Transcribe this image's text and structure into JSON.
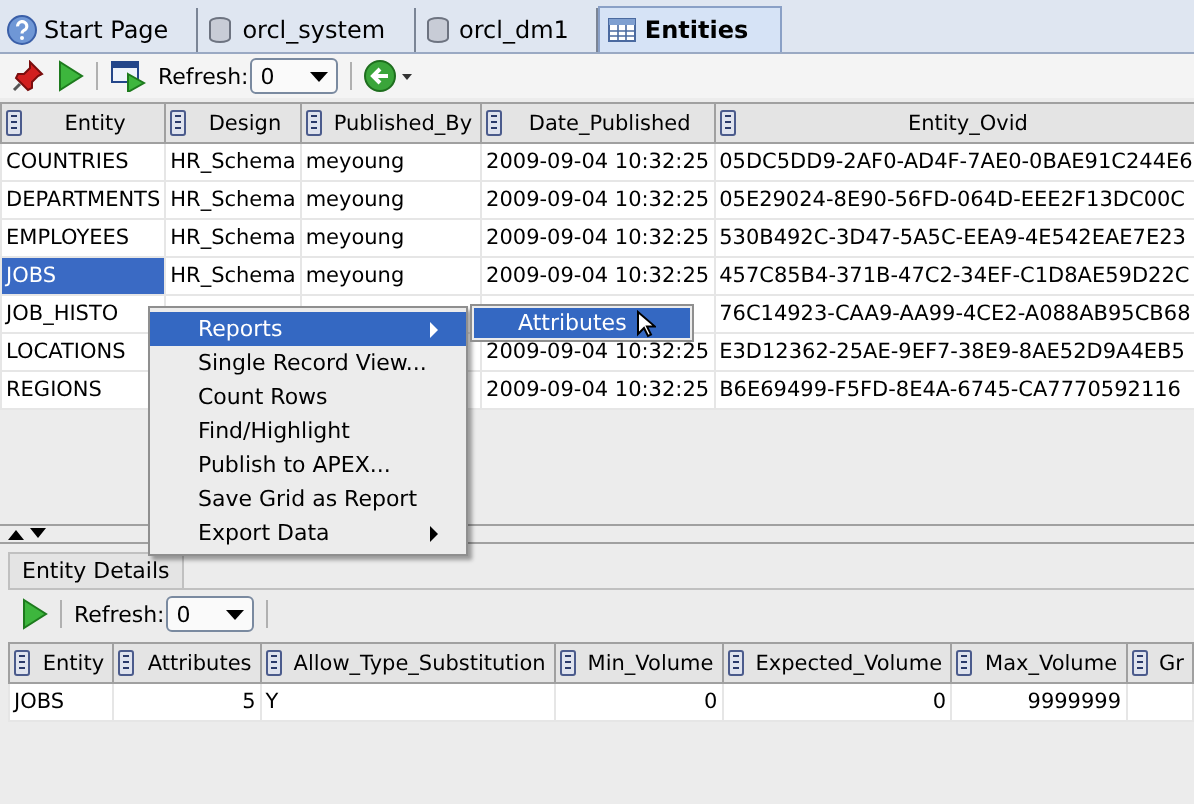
{
  "tabs": [
    {
      "label": "Start Page",
      "selected": false
    },
    {
      "label": "orcl_system",
      "selected": false
    },
    {
      "label": "orcl_dm1",
      "selected": false
    },
    {
      "label": "Entities",
      "selected": true
    }
  ],
  "toolbar": {
    "refresh_label": "Refresh:",
    "refresh_value": "0"
  },
  "grid": {
    "columns": [
      "Entity",
      "Design",
      "Published_By",
      "Date_Published",
      "Entity_Ovid"
    ],
    "rows": [
      {
        "cells": [
          "COUNTRIES",
          "HR_Schema",
          "meyoung",
          "2009-09-04 10:32:25",
          "05DC5DD9-2AF0-AD4F-7AE0-0BAE91C244E6"
        ],
        "selected": false
      },
      {
        "cells": [
          "DEPARTMENTS",
          "HR_Schema",
          "meyoung",
          "2009-09-04 10:32:25",
          "05E29024-8E90-56FD-064D-EEE2F13DC00C"
        ],
        "selected": false
      },
      {
        "cells": [
          "EMPLOYEES",
          "HR_Schema",
          "meyoung",
          "2009-09-04 10:32:25",
          "530B492C-3D47-5A5C-EEA9-4E542EAE7E23"
        ],
        "selected": false
      },
      {
        "cells": [
          "JOBS",
          "HR_Schema",
          "meyoung",
          "2009-09-04 10:32:25",
          "457C85B4-371B-47C2-34EF-C1D8AE59D22C"
        ],
        "selected": true
      },
      {
        "cells": [
          "JOB_HISTO",
          null,
          null,
          null,
          "76C14923-CAA9-AA99-4CE2-A088AB95CB68"
        ],
        "selected": false
      },
      {
        "cells": [
          "LOCATIONS",
          null,
          null,
          "2009-09-04 10:32:25",
          "E3D12362-25AE-9EF7-38E9-8AE52D9A4EB5"
        ],
        "selected": false
      },
      {
        "cells": [
          "REGIONS",
          null,
          null,
          "2009-09-04 10:32:25",
          "B6E69499-F5FD-8E4A-6745-CA7770592116"
        ],
        "selected": false
      }
    ]
  },
  "context_menu": {
    "items": [
      {
        "label": "Reports",
        "submenu": true,
        "selected": true
      },
      {
        "label": "Single Record View...",
        "submenu": false,
        "selected": false
      },
      {
        "label": "Count Rows",
        "submenu": false,
        "selected": false
      },
      {
        "label": "Find/Highlight",
        "submenu": false,
        "selected": false
      },
      {
        "label": "Publish to APEX...",
        "submenu": false,
        "selected": false
      },
      {
        "label": "Save Grid as Report",
        "submenu": false,
        "selected": false
      },
      {
        "label": "Export Data",
        "submenu": true,
        "selected": false
      }
    ],
    "submenu_items": [
      {
        "label": "Attributes",
        "selected": true
      }
    ]
  },
  "details": {
    "tab": "Entity Details",
    "refresh_label": "Refresh:",
    "refresh_value": "0",
    "columns": [
      "Entity",
      "Attributes",
      "Allow_Type_Substitution",
      "Min_Volume",
      "Expected_Volume",
      "Max_Volume",
      "Gr"
    ],
    "rows": [
      [
        "JOBS",
        "5",
        "Y",
        "0",
        "0",
        "9999999",
        null
      ]
    ]
  }
}
